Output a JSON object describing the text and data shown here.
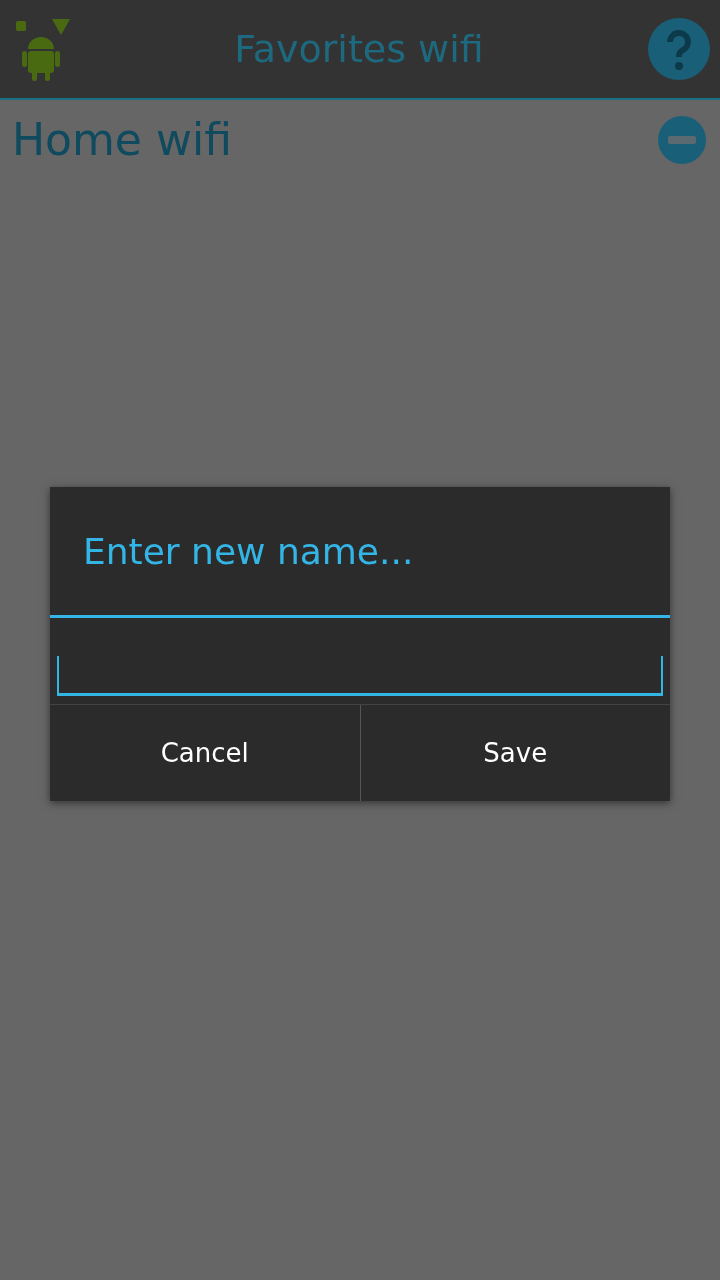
{
  "app_bar": {
    "title": "Favorites wifi"
  },
  "favorites": [
    {
      "name": "Home wifi"
    }
  ],
  "dialog": {
    "title": "Enter new name...",
    "buttons": [
      "Cancel",
      "Save"
    ]
  }
}
